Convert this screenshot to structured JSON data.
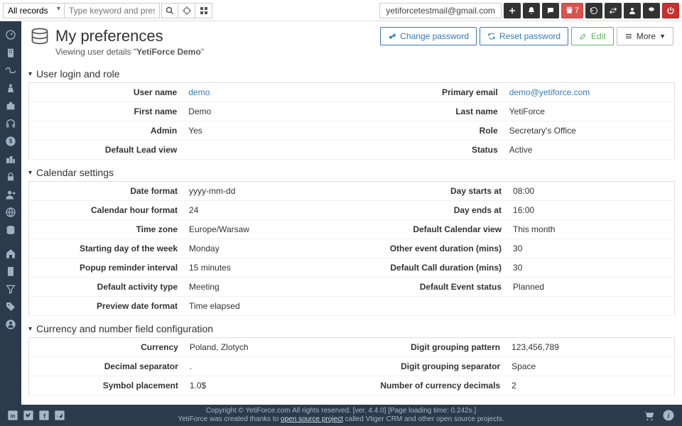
{
  "topbar": {
    "records_selector": "All records",
    "search_placeholder": "Type keyword and press enter",
    "email": "yetiforcetestmail@gmail.com",
    "calendar_badge": "7"
  },
  "header": {
    "title": "My preferences",
    "subtitle_prefix": "Viewing user details \"",
    "subtitle_bold": "YetiForce Demo",
    "subtitle_suffix": "\"",
    "change_password": "Change password",
    "reset_password": "Reset password",
    "edit": "Edit",
    "more": "More"
  },
  "sections": {
    "login": {
      "title": "User login and role",
      "rows": [
        {
          "l1": "User name",
          "v1": "demo",
          "l2": "Primary email",
          "v2": "demo@yetiforce.com",
          "link": true
        },
        {
          "l1": "First name",
          "v1": "Demo",
          "l2": "Last name",
          "v2": "YetiForce"
        },
        {
          "l1": "Admin",
          "v1": "Yes",
          "l2": "Role",
          "v2": "Secretary's Office"
        },
        {
          "l1": "Default Lead view",
          "v1": "",
          "l2": "Status",
          "v2": "Active"
        }
      ]
    },
    "calendar": {
      "title": "Calendar settings",
      "rows": [
        {
          "l1": "Date format",
          "v1": "yyyy-mm-dd",
          "l2": "Day starts at",
          "v2": "08:00"
        },
        {
          "l1": "Calendar hour format",
          "v1": "24",
          "l2": "Day ends at",
          "v2": "16:00"
        },
        {
          "l1": "Time zone",
          "v1": "Europe/Warsaw",
          "l2": "Default Calendar view",
          "v2": "This month"
        },
        {
          "l1": "Starting day of the week",
          "v1": "Monday",
          "l2": "Other event duration (mins)",
          "v2": "30"
        },
        {
          "l1": "Popup reminder interval",
          "v1": "15 minutes",
          "l2": "Default Call duration (mins)",
          "v2": "30"
        },
        {
          "l1": "Default activity type",
          "v1": "Meeting",
          "l2": "Default Event status",
          "v2": "Planned"
        },
        {
          "l1": "Preview date format",
          "v1": "Time elapsed",
          "l2": "",
          "v2": ""
        }
      ]
    },
    "currency": {
      "title": "Currency and number field configuration",
      "rows": [
        {
          "l1": "Currency",
          "v1": "Poland, Zlotych",
          "l2": "Digit grouping pattern",
          "v2": "123,456,789"
        },
        {
          "l1": "Decimal separator",
          "v1": ".",
          "l2": "Digit grouping separator",
          "v2": "Space"
        },
        {
          "l1": "Symbol placement",
          "v1": "1.0$",
          "l2": "Number of currency decimals",
          "v2": "2"
        }
      ]
    }
  },
  "footer": {
    "line1_a": "Copyright © YetiForce.com All rights reserved. [ver. 4.4.0] [Page loading time: 0.242s.]",
    "line2_a": "YetiForce was created thanks to ",
    "line2_link": "open source project",
    "line2_b": " called Vtiger CRM and other open source projects."
  }
}
